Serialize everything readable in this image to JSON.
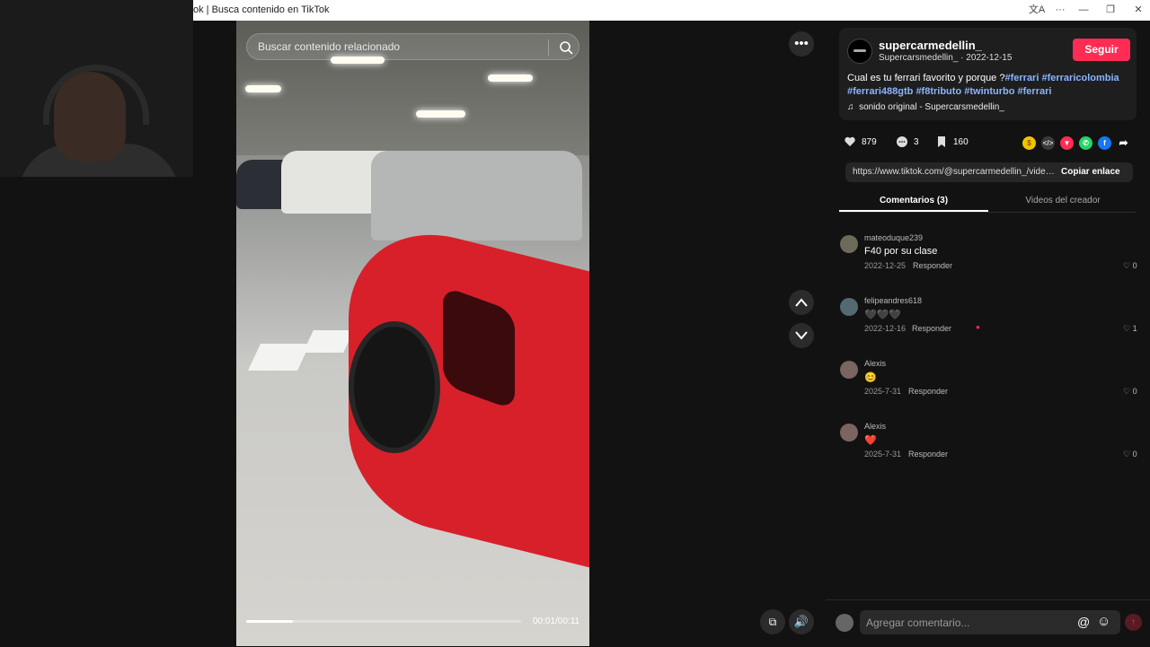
{
  "window": {
    "title": "ok | Busca contenido en TikTok",
    "controls": [
      "translate-icon",
      "more-icon",
      "minimize-icon",
      "restore-icon",
      "close-icon"
    ]
  },
  "video": {
    "search_placeholder": "Buscar contenido relacionado",
    "time": "00:01/00:11",
    "progress": 0.17
  },
  "post": {
    "username": "supercarmedellin_",
    "subtitle": "Supercarsmedellin_ · 2022-12-15",
    "follow_label": "Seguir",
    "desc_text": "Cual es tu ferrari favorito y porque ?",
    "hashtags": [
      "#ferrari",
      "#ferraricolombia",
      "#ferrari488gtb",
      "#f8tributo",
      "#twinturbo",
      "#ferrari"
    ],
    "music": "sonido original - Supercarsmedellin_"
  },
  "stats": {
    "likes": "879",
    "comments": "3",
    "saves": "160"
  },
  "share_colors": {
    "coin": "#f2c200",
    "embed": "#3a3a3a",
    "repost": "#fe2c55",
    "whatsapp": "#25d366",
    "facebook": "#1877f2"
  },
  "link": {
    "url": "https://www.tiktok.com/@supercarmedellin_/video...",
    "copy_label": "Copiar enlace"
  },
  "tabs": {
    "comments": "Comentarios (3)",
    "creator": "Videos del creador"
  },
  "comments": [
    {
      "user": "mateoduque239",
      "text": "F40 por su clase",
      "date": "2022-12-25",
      "reply": "Responder",
      "likes": "0"
    },
    {
      "user": "felipeandres618",
      "text": "🖤🖤🖤",
      "date": "2022-12-16",
      "reply": "Responder",
      "likes": "1"
    },
    {
      "user": "Alexis",
      "text": "😊",
      "date": "2025-7-31",
      "reply": "Responder",
      "likes": "0"
    },
    {
      "user": "Alexis",
      "text": "❤️",
      "date": "2025-7-31",
      "reply": "Responder",
      "likes": "0"
    }
  ],
  "composer": {
    "placeholder": "Agregar comentario..."
  }
}
